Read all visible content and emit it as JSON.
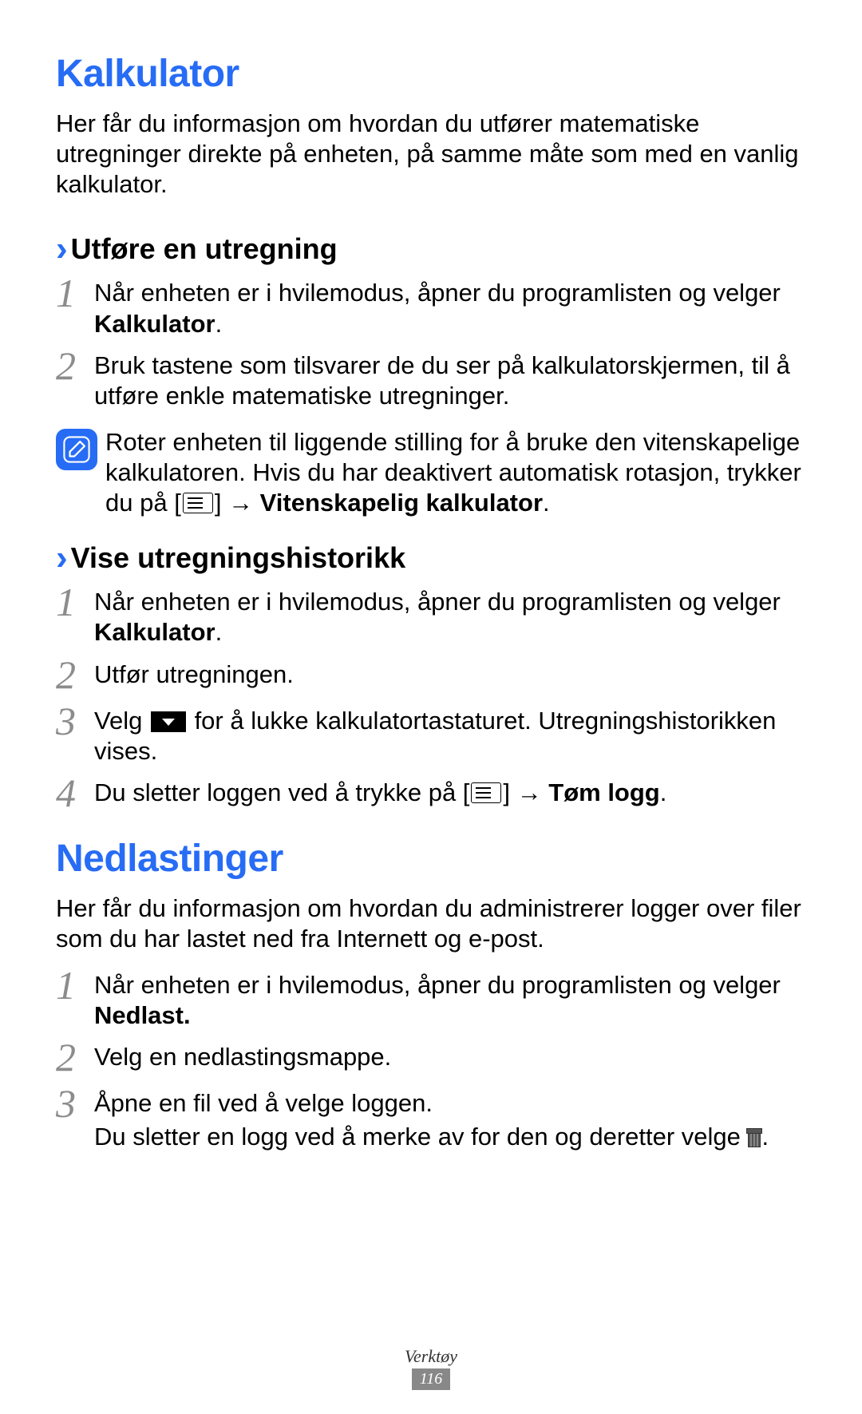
{
  "section1": {
    "title": "Kalkulator",
    "intro": "Her får du informasjon om hvordan du utfører matematiske utregninger direkte på enheten, på samme måte som med en vanlig kalkulator.",
    "sub1": {
      "title": "Utføre en utregning",
      "step1_pre": "Når enheten er i hvilemodus, åpner du programlisten og velger ",
      "step1_bold": "Kalkulator",
      "step1_post": ".",
      "step2": "Bruk tastene som tilsvarer de du ser på kalkulatorskjermen, til å utføre enkle matematiske utregninger.",
      "note_pre": "Roter enheten til liggende stilling for å bruke den vitenskapelige kalkulatoren. Hvis du har deaktivert automatisk rotasjon, trykker du på [",
      "note_mid": "] → ",
      "note_bold": "Vitenskapelig kalkulator",
      "note_post": "."
    },
    "sub2": {
      "title": "Vise utregningshistorikk",
      "step1_pre": "Når enheten er i hvilemodus, åpner du programlisten og velger ",
      "step1_bold": "Kalkulator",
      "step1_post": ".",
      "step2": "Utfør utregningen.",
      "step3_pre": "Velg ",
      "step3_post": " for å lukke kalkulatortastaturet. Utregningshistorikken vises.",
      "step4_pre": "Du sletter loggen ved å trykke på [",
      "step4_mid": "] → ",
      "step4_bold": "Tøm logg",
      "step4_post": "."
    }
  },
  "section2": {
    "title": "Nedlastinger",
    "intro": "Her får du informasjon om hvordan du administrerer logger over filer som du har lastet ned fra Internett og e-post.",
    "step1_pre": "Når enheten er i hvilemodus, åpner du programlisten og velger ",
    "step1_bold": "Nedlast.",
    "step2": "Velg en nedlastingsmappe.",
    "step3_a": "Åpne en fil ved å velge loggen.",
    "step3_b_pre": "Du sletter en logg ved å merke av for den og deretter velge ",
    "step3_b_post": "."
  },
  "footer": {
    "category": "Verktøy",
    "page": "116"
  }
}
